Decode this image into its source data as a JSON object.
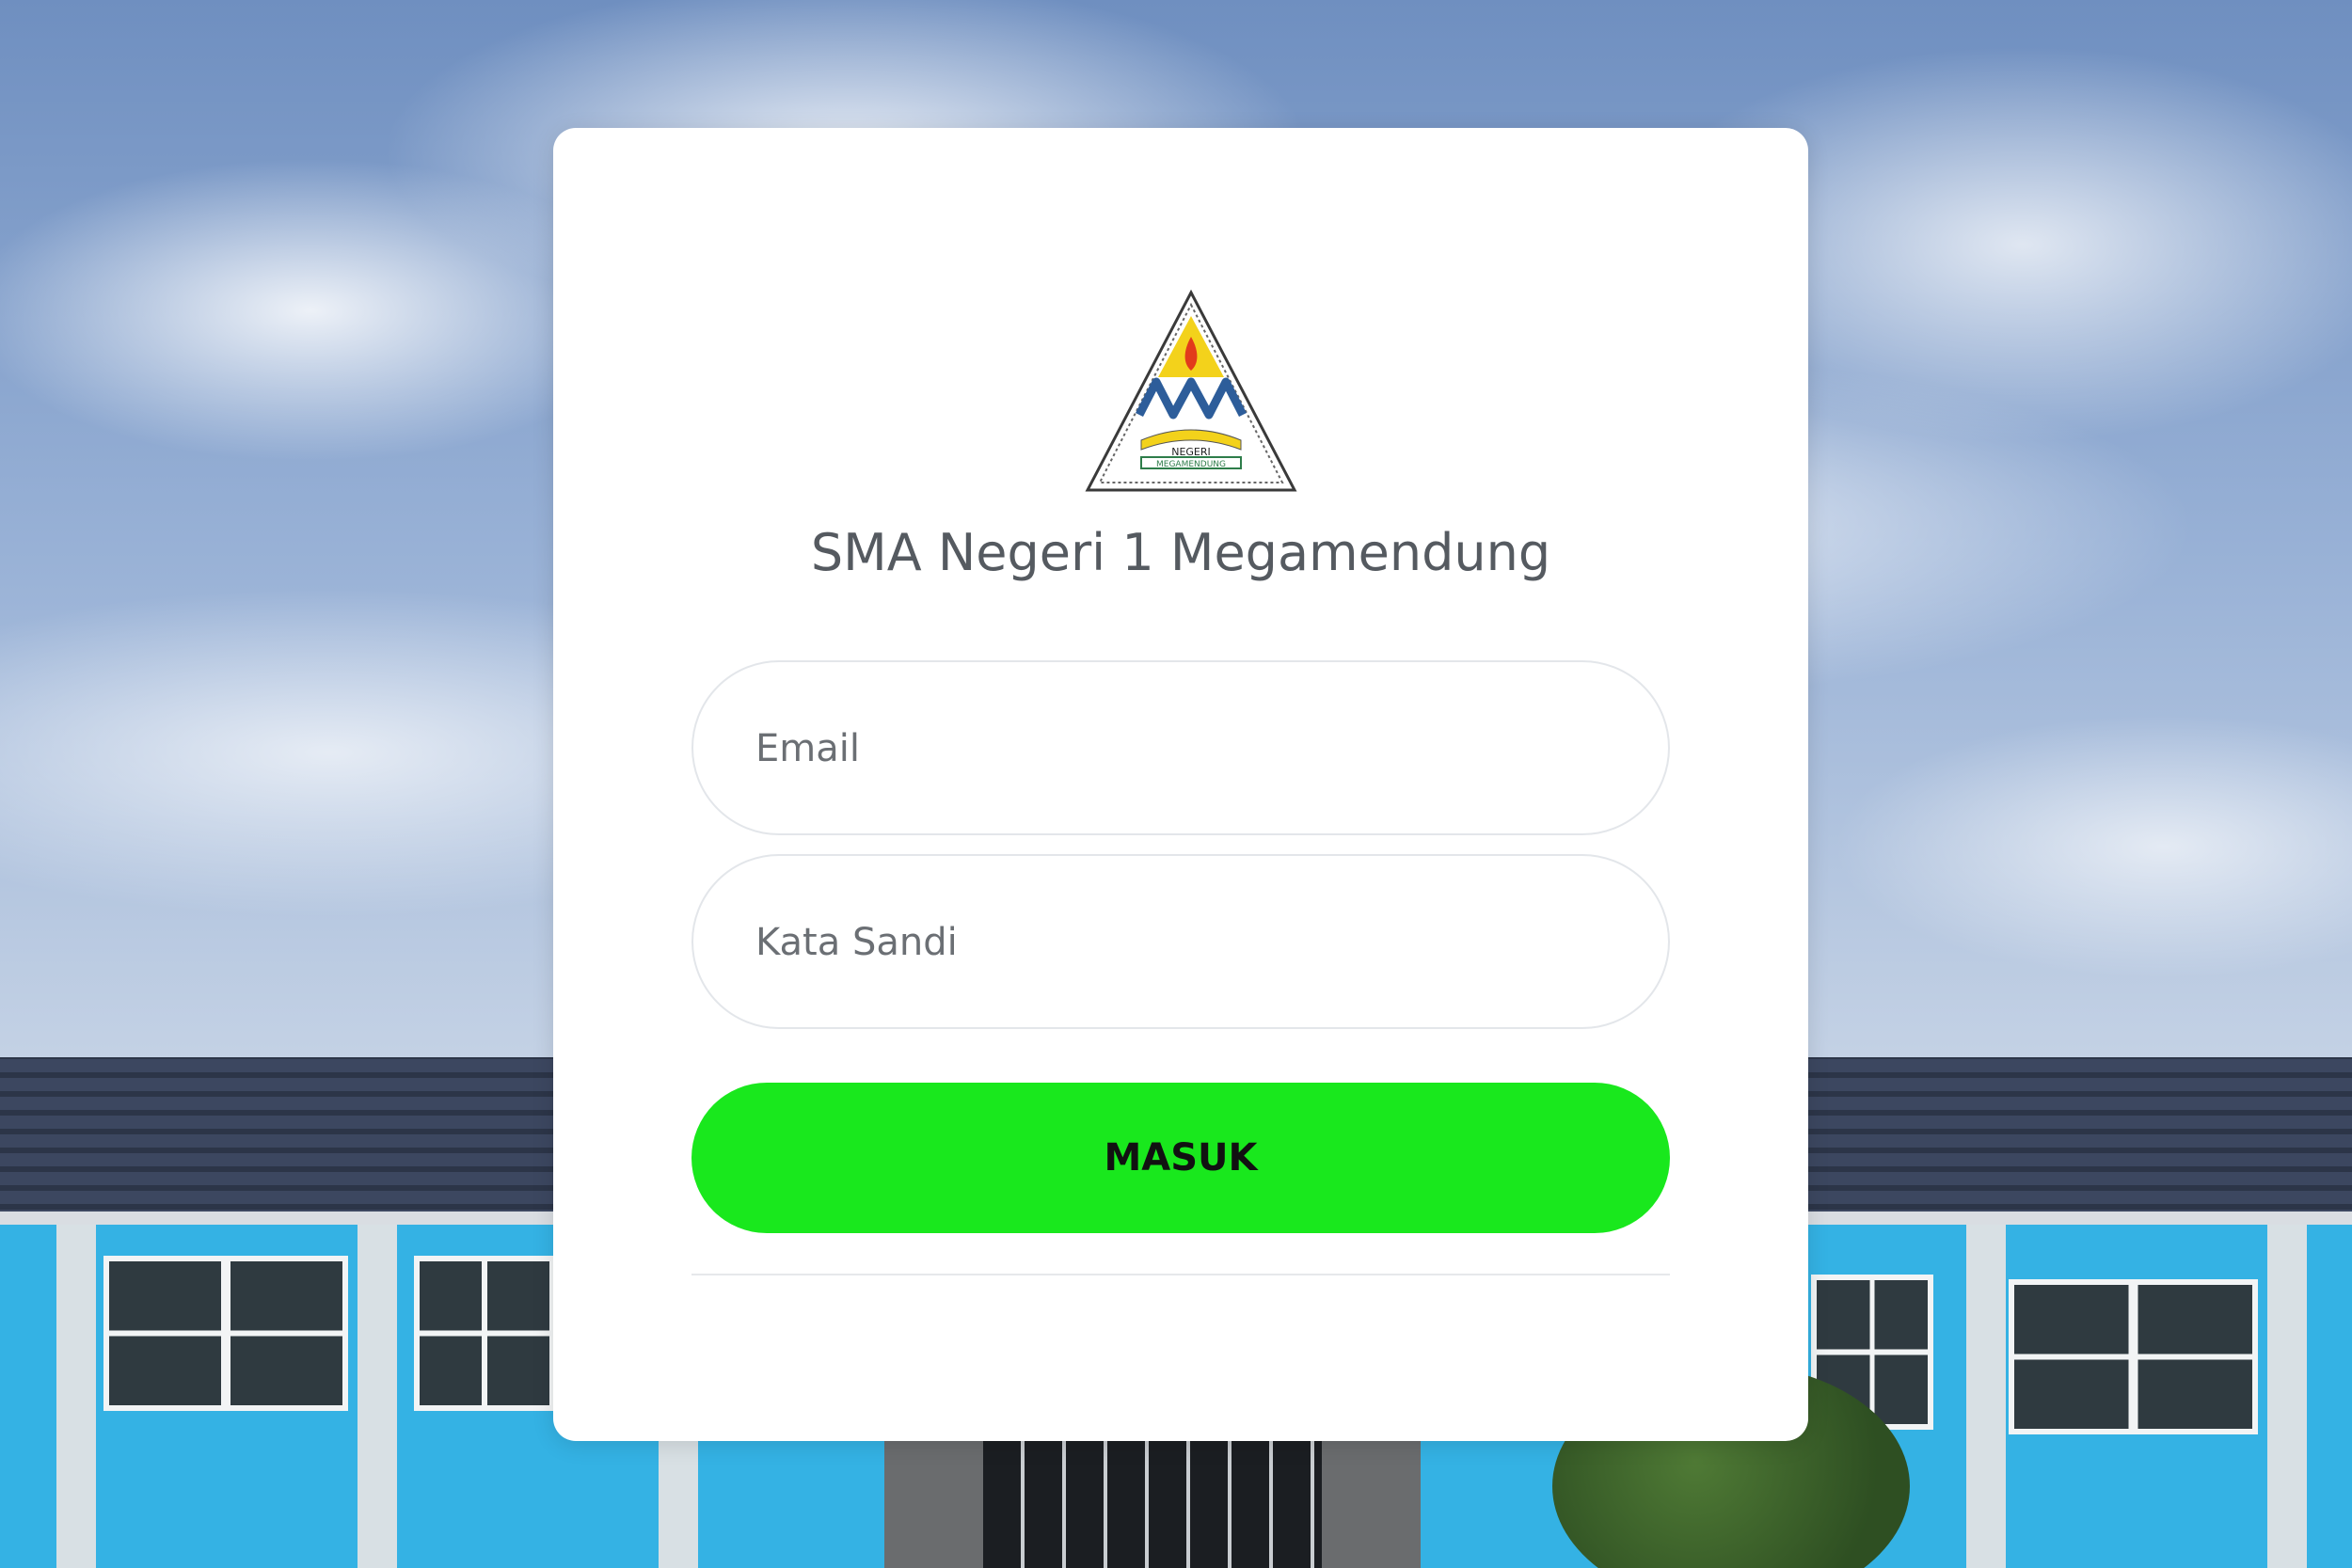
{
  "login": {
    "school_name": "SMA Negeri 1 Megamendung",
    "logo": {
      "text_top": "NEGERI",
      "text_bottom": "MEGAMENDUNG"
    },
    "email_placeholder": "Email",
    "password_placeholder": "Kata Sandi",
    "submit_label": "MASUK"
  },
  "colors": {
    "button": "#19e81d",
    "card": "#ffffff",
    "text": "#555a60"
  }
}
